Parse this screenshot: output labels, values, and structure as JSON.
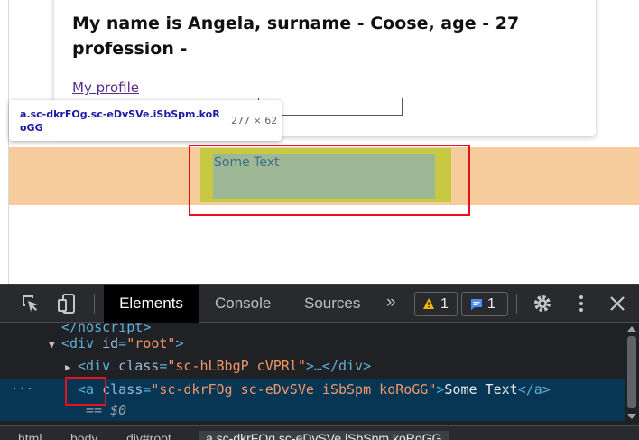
{
  "page": {
    "card_title": "My name is Angela, surname - Coose, age - 27 profession -",
    "profile_link": "My profile",
    "some_text": "Some Text"
  },
  "tooltip": {
    "selector": "a.sc-dkrFOg.sc-eDvSVe.iSbSpm.koRoGG",
    "size": "277 × 62"
  },
  "devtools": {
    "tabs": [
      {
        "label": "Elements",
        "active": true
      },
      {
        "label": "Console",
        "active": false
      },
      {
        "label": "Sources",
        "active": false
      }
    ],
    "more_tabs": "»",
    "warnings_count": "1",
    "messages_count": "1",
    "tree": {
      "noscript_line": "</noscript>",
      "root_line": {
        "open": "<div ",
        "attr": "id",
        "eq": "=",
        "val": "\"root\"",
        "close": ">"
      },
      "div_line": {
        "open": "<div ",
        "attr": "class",
        "eq": "=",
        "val": "\"sc-hLBbgP cVPRl\"",
        "close": ">…</div>"
      },
      "a_line": {
        "dots": "···",
        "open": "<a ",
        "attr": "class",
        "eq": "=",
        "val": "\"sc-dkrFOg sc-eDvSVe iSbSpm koRoGG\"",
        "gt": ">",
        "text": "Some Text",
        "close": "</a>"
      },
      "eq_line": "== $0"
    },
    "breadcrumbs": [
      "html",
      "body",
      "div#root",
      "a.sc-dkrFOg.sc-eDvSVe.iSbSpm.koRoGG"
    ]
  },
  "colors": {
    "highlight_margin": "#c7c942",
    "highlight_content": "#9eb896",
    "band": "#f7cc9c",
    "annotation_red": "#e8101c"
  }
}
